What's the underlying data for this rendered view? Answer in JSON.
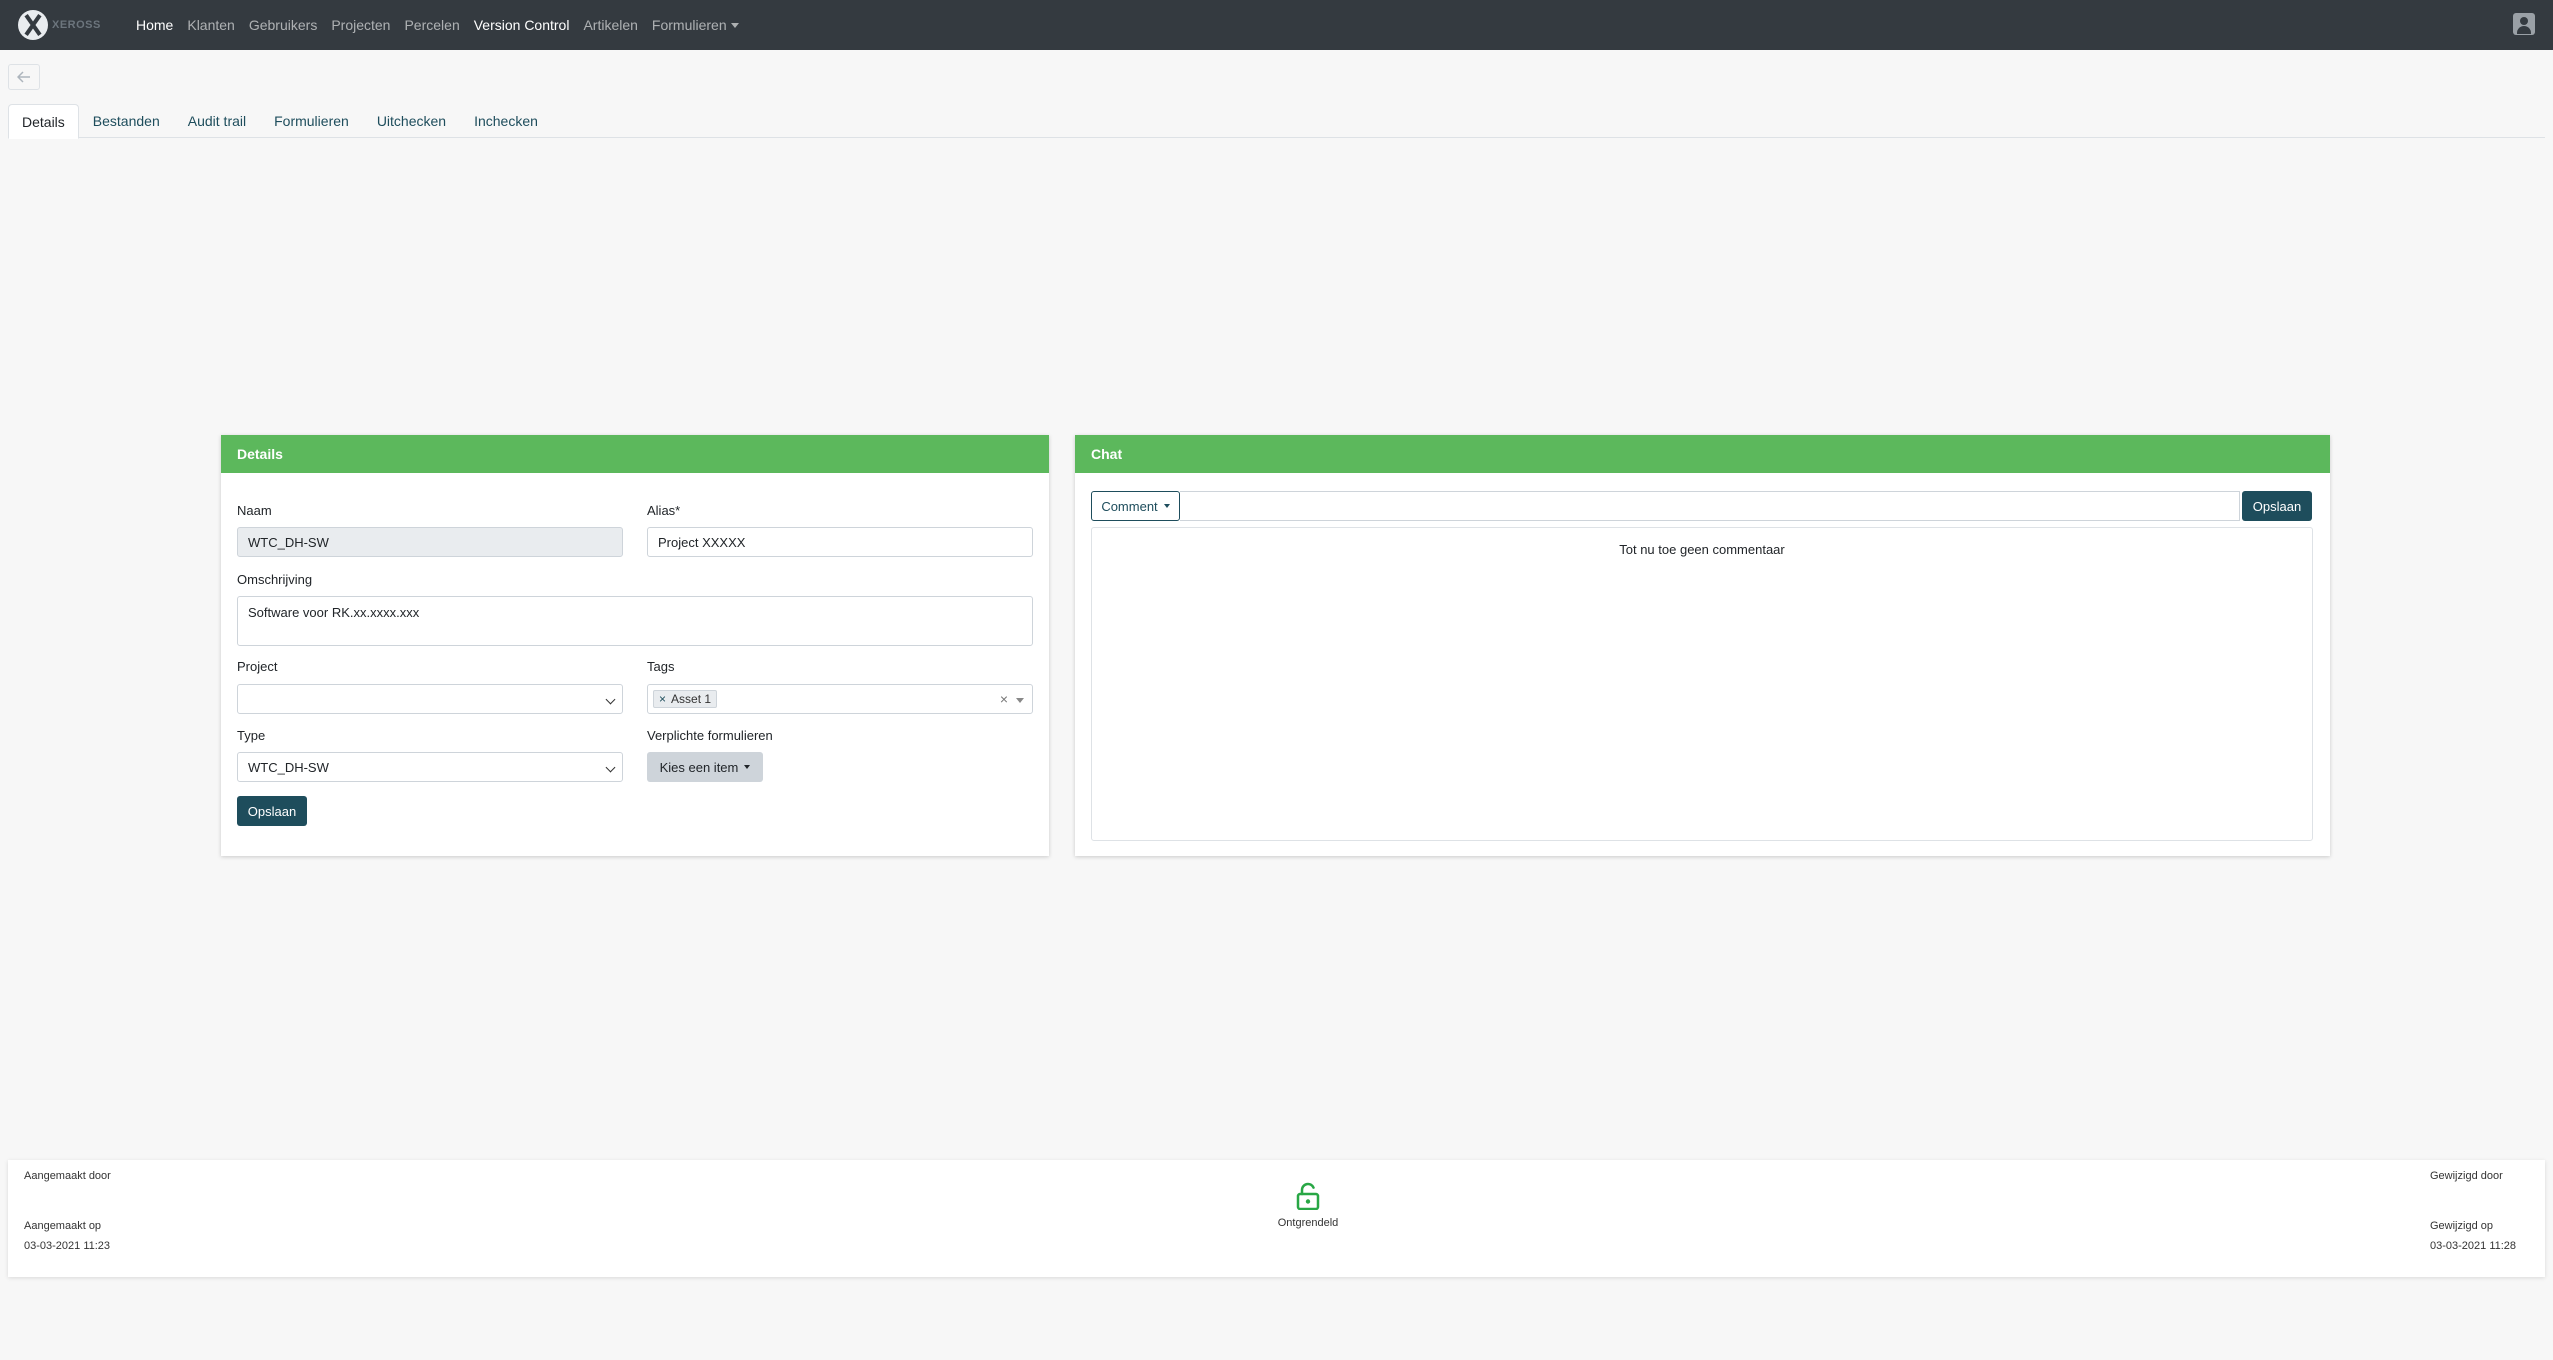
{
  "navbar": {
    "logo_text": "XEROSS",
    "links": [
      "Home",
      "Klanten",
      "Gebruikers",
      "Projecten",
      "Percelen",
      "Version Control",
      "Artikelen",
      "Formulieren"
    ]
  },
  "tabs": [
    "Details",
    "Bestanden",
    "Audit trail",
    "Formulieren",
    "Uitchecken",
    "Inchecken"
  ],
  "details": {
    "header": "Details",
    "naam_label": "Naam",
    "naam_value": "WTC_DH-SW",
    "alias_label": "Alias*",
    "alias_value": "Project XXXXX",
    "omschrijving_label": "Omschrijving",
    "omschrijving_value": "Software voor RK.xx.xxxx.xxx",
    "project_label": "Project",
    "project_value": "",
    "tags_label": "Tags",
    "tag_x": "×",
    "tag_value": "Asset 1",
    "tags_clear": "×",
    "type_label": "Type",
    "type_value": "WTC_DH-SW",
    "verplichte_label": "Verplichte formulieren",
    "kies_label": "Kies een item",
    "save_label": "Opslaan"
  },
  "chat": {
    "header": "Chat",
    "comment_label": "Comment",
    "save_label": "Opslaan",
    "empty_text": "Tot nu toe geen commentaar"
  },
  "footer": {
    "created_by_label": "Aangemaakt door",
    "created_on_label": "Aangemaakt op",
    "created_on_value": "03-03-2021 11:23",
    "lock_status": "Ontgrendeld",
    "modified_by_label": "Gewijzigd door",
    "modified_on_label": "Gewijzigd op",
    "modified_on_value": "03-03-2021 11:28"
  },
  "colors": {
    "navbar": "#343a40",
    "card_header": "#5cb85c",
    "primary": "#1e4d5c",
    "lock_icon": "#28a745"
  }
}
